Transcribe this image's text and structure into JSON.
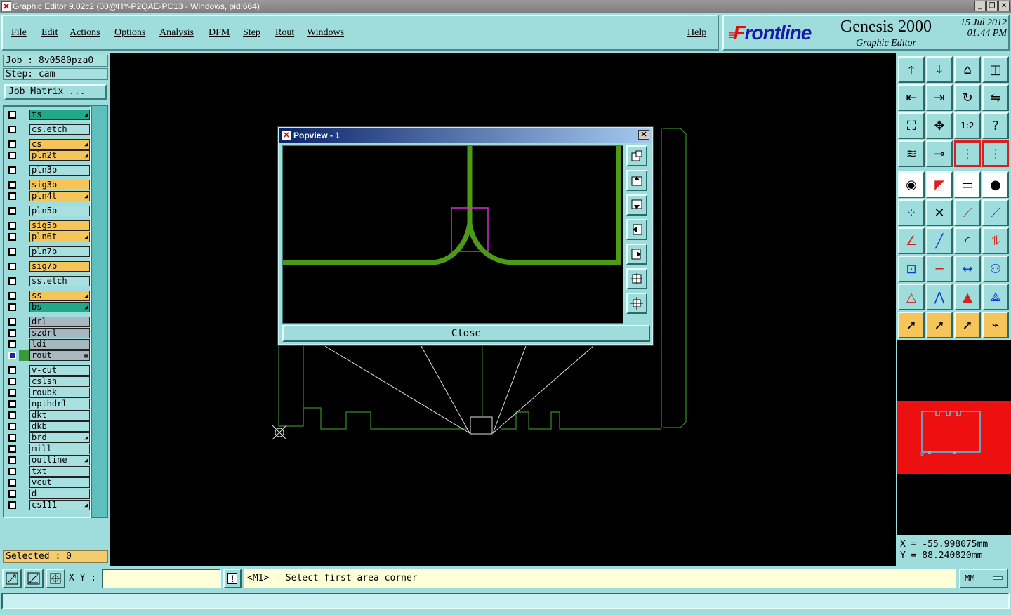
{
  "window": {
    "title": "Graphic Editor 9.02c2 (00@HY-P2QAE-PC13 - Windows, pid:664)"
  },
  "menu": {
    "file": "File",
    "edit": "Edit",
    "actions": "Actions",
    "options": "Options",
    "analysis": "Analysis",
    "dfm": "DFM",
    "step": "Step",
    "rout": "Rout",
    "windows": "Windows",
    "help": "Help"
  },
  "brand": {
    "logo_f": "F",
    "logo_rest": "rontline",
    "product": "Genesis 2000",
    "subtitle": "Graphic Editor",
    "date": "15 Jul 2012",
    "time": "01:44 PM"
  },
  "job": {
    "job_label": "Job : 8v0580pza0",
    "step_label": "Step: cam",
    "matrix_button": "Job Matrix ..."
  },
  "layers": [
    {
      "name": "ts",
      "color": "#20a888",
      "arrow": true
    },
    {
      "name": "cs.etch",
      "color": "#a8e0e0",
      "arrow": false
    },
    {
      "name": "cs",
      "color": "#f6c55a",
      "arrow": true
    },
    {
      "name": "pln2t",
      "color": "#f6c55a",
      "arrow": true
    },
    {
      "name": "pln3b",
      "color": "#a8e0e0",
      "arrow": false
    },
    {
      "name": "sig3b",
      "color": "#f6c55a",
      "arrow": false
    },
    {
      "name": "pln4t",
      "color": "#f6c55a",
      "arrow": true
    },
    {
      "name": "pln5b",
      "color": "#a8e0e0",
      "arrow": false
    },
    {
      "name": "sig5b",
      "color": "#f6c55a",
      "arrow": false
    },
    {
      "name": "pln6t",
      "color": "#f6c55a",
      "arrow": true
    },
    {
      "name": "pln7b",
      "color": "#a8e0e0",
      "arrow": false
    },
    {
      "name": "sig7b",
      "color": "#f6c55a",
      "arrow": false
    },
    {
      "name": "ss.etch",
      "color": "#a8e0e0",
      "arrow": false
    },
    {
      "name": "ss",
      "color": "#f6c55a",
      "arrow": true
    },
    {
      "name": "bs",
      "color": "#20a888",
      "arrow": true
    },
    {
      "name": "drl",
      "color": "#a8b8c0",
      "arrow": false
    },
    {
      "name": "szdrl",
      "color": "#a8b8c0",
      "arrow": false
    },
    {
      "name": "ldi",
      "color": "#a8b8c0",
      "arrow": false
    },
    {
      "name": "rout",
      "color": "#a8b8c0",
      "arrow": false,
      "active": true
    },
    {
      "name": "v-cut",
      "color": "#a8e0e0",
      "arrow": false
    },
    {
      "name": "cslsh",
      "color": "#a8e0e0",
      "arrow": false
    },
    {
      "name": "roubk",
      "color": "#a8e0e0",
      "arrow": false
    },
    {
      "name": "npthdrl",
      "color": "#a8e0e0",
      "arrow": false
    },
    {
      "name": "dkt",
      "color": "#a8e0e0",
      "arrow": false
    },
    {
      "name": "dkb",
      "color": "#a8e0e0",
      "arrow": false
    },
    {
      "name": "brd",
      "color": "#a8e0e0",
      "arrow": true
    },
    {
      "name": "mill",
      "color": "#a8e0e0",
      "arrow": false
    },
    {
      "name": "outline",
      "color": "#a8e0e0",
      "arrow": true
    },
    {
      "name": "txt",
      "color": "#a8e0e0",
      "arrow": false
    },
    {
      "name": "vcut",
      "color": "#a8e0e0",
      "arrow": false
    },
    {
      "name": "d",
      "color": "#a8e0e0",
      "arrow": false
    },
    {
      "name": "cs111",
      "color": "#a8e0e0",
      "arrow": true
    }
  ],
  "selected": "Selected : 0",
  "popview": {
    "title": "Popview - 1",
    "close_button": "Close"
  },
  "coords": {
    "x": "X = -55.998075mm",
    "y": "Y = 88.240820mm"
  },
  "status": {
    "xy_label": "X Y :",
    "xy_value": "",
    "message": "<M1> - Select first area corner",
    "units": "MM"
  },
  "colors": {
    "board": "#3a8a2a",
    "trace": "#4c9a18",
    "selection": "#d030d0",
    "minimap": "#ee1010"
  }
}
